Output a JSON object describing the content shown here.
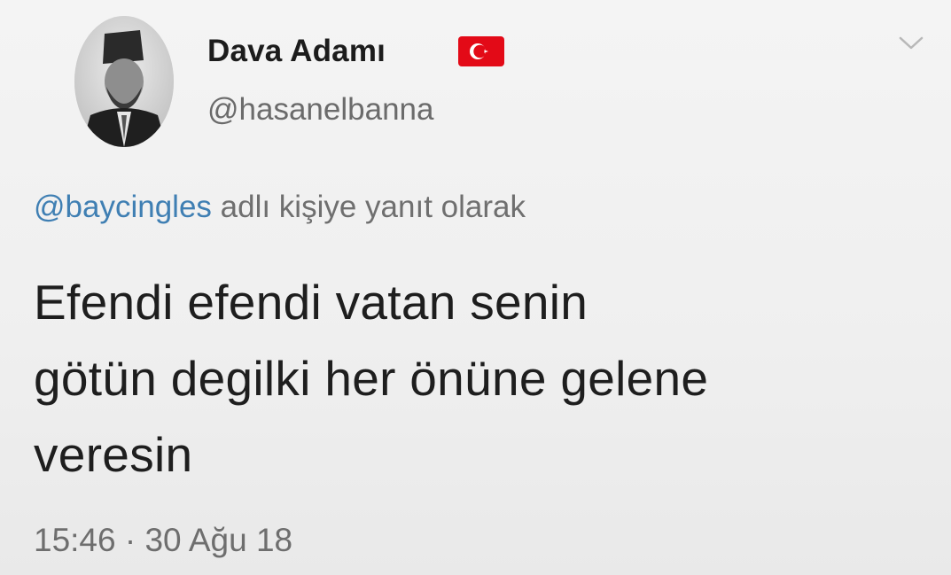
{
  "tweet": {
    "author": {
      "display_name": "Dava Adamı",
      "handle": "@hasanelbanna",
      "flag_icon": "turkey-flag-icon"
    },
    "menu_icon": "chevron-down-icon",
    "reply_to": {
      "mention": "@baycingles",
      "suffix": " adlı kişiye yanıt olarak"
    },
    "text_lines": [
      "Efendi efendi vatan senin",
      "götün degilki her önüne gelene",
      "veresin"
    ],
    "timestamp": "15:46 · 30 Ağu 18"
  },
  "colors": {
    "mention": "#3f7fb3",
    "flag_red": "#e30a17",
    "text": "#1e1e1e",
    "muted": "#6e6e6e"
  }
}
